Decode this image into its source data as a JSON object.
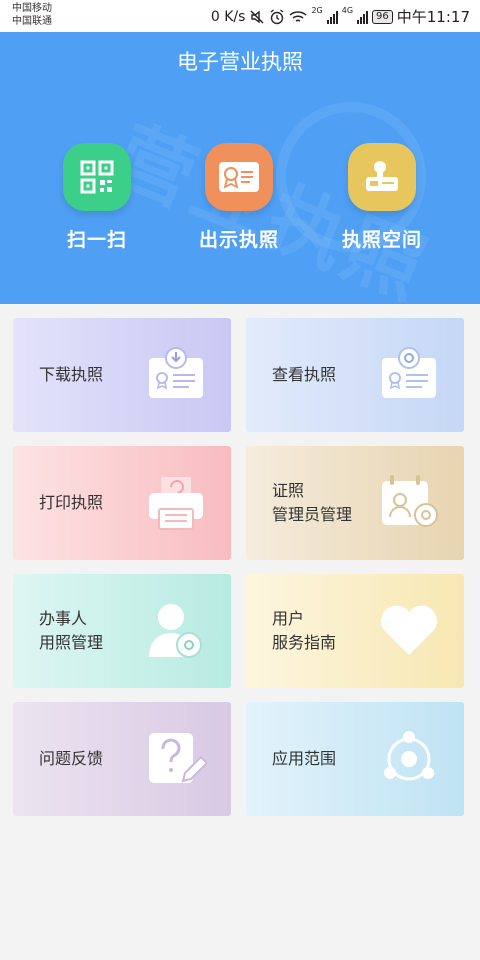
{
  "status_bar": {
    "carrier1": "中国移动",
    "carrier2": "中国联通",
    "speed": "0 K/s",
    "battery": "96",
    "time": "中午11:17",
    "net1": "2G",
    "net2": "4G"
  },
  "header": {
    "title": "电子营业执照",
    "watermark": "营业执照",
    "bg_color": "#4fa0f5"
  },
  "quick_actions": [
    {
      "label": "扫一扫",
      "icon": "qr-code-icon",
      "color": "#3ccf8a"
    },
    {
      "label": "出示执照",
      "icon": "license-card-icon",
      "color": "#f0905a"
    },
    {
      "label": "执照空间",
      "icon": "license-space-icon",
      "color": "#e8c65e"
    }
  ],
  "cards": [
    {
      "label_line1": "下载执照",
      "label_line2": "",
      "icon": "download-license-icon"
    },
    {
      "label_line1": "查看执照",
      "label_line2": "",
      "icon": "view-license-icon"
    },
    {
      "label_line1": "打印执照",
      "label_line2": "",
      "icon": "printer-icon"
    },
    {
      "label_line1": "证照",
      "label_line2": "管理员管理",
      "icon": "admin-manage-icon"
    },
    {
      "label_line1": "办事人",
      "label_line2": "用照管理",
      "icon": "agent-manage-icon"
    },
    {
      "label_line1": "用户",
      "label_line2": "服务指南",
      "icon": "heart-icon"
    },
    {
      "label_line1": "问题反馈",
      "label_line2": "",
      "icon": "feedback-icon"
    },
    {
      "label_line1": "应用范围",
      "label_line2": "",
      "icon": "scope-icon"
    }
  ]
}
